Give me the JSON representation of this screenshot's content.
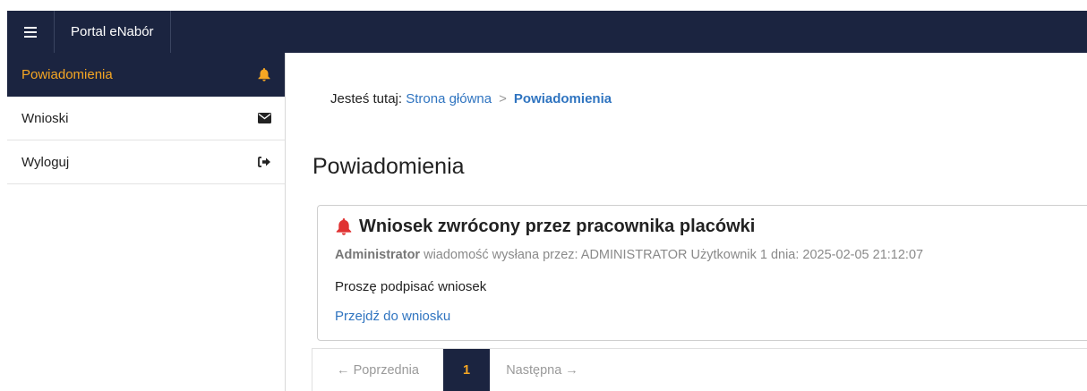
{
  "header": {
    "brand": "Portal eNabór",
    "menu_icon": "hamburger-icon"
  },
  "sidebar": {
    "items": [
      {
        "label": "Powiadomienia",
        "icon": "bell-icon",
        "active": true
      },
      {
        "label": "Wnioski",
        "icon": "envelope-icon",
        "active": false
      },
      {
        "label": "Wyloguj",
        "icon": "sign-out-icon",
        "active": false
      }
    ]
  },
  "breadcrumb": {
    "prefix": "Jesteś tutaj:",
    "home": "Strona główna",
    "separator": ">",
    "current": "Powiadomienia"
  },
  "page": {
    "title": "Powiadomienia"
  },
  "notification": {
    "title": "Wniosek zwrócony przez pracownika placówki",
    "author": "Administrator",
    "meta": " wiadomość wysłana przez: ADMINISTRATOR Użytkownik 1 dnia: 2025-02-05 21:12:07",
    "body": "Proszę podpisać wniosek",
    "link": "Przejdź do wniosku",
    "icon": "bell-icon",
    "icon_color": "#e03131"
  },
  "pagination": {
    "prev": "← Poprzednia",
    "current": "1",
    "next": "Następna →"
  },
  "colors": {
    "navy": "#1b2440",
    "accent": "#f5a623",
    "link": "#2f74c0"
  }
}
